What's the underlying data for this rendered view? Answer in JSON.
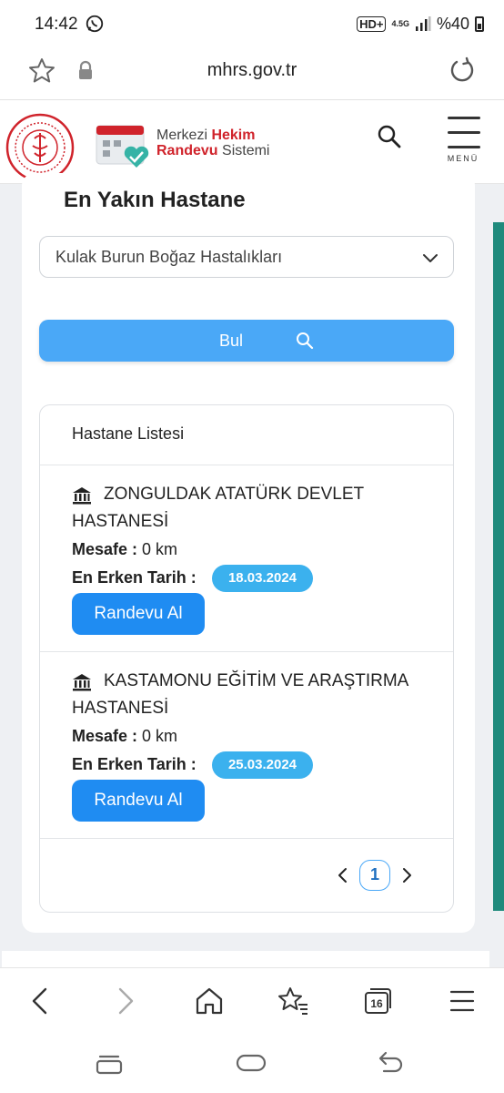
{
  "status_bar": {
    "time": "14:42",
    "network_type": "4.5G",
    "hd_label": "HD+",
    "battery": "%40"
  },
  "browser": {
    "url": "mhrs.gov.tr",
    "tab_count": "16"
  },
  "site_header": {
    "brand_line1_part1": "Merkezi ",
    "brand_line1_part2": "Hekim",
    "brand_line2_part1": "Randevu",
    "brand_line2_part2": " Sistemi",
    "menu_label": "MENÜ"
  },
  "page": {
    "title": "En Yakın Hastane",
    "clinic_select_value": "Kulak Burun Boğaz Hastalıkları",
    "find_button_label": "Bul",
    "list_title": "Hastane Listesi",
    "distance_label": "Mesafe :",
    "earliest_date_label": "En Erken Tarih :",
    "appointment_button_label": "Randevu Al",
    "hospitals": [
      {
        "name": "ZONGULDAK ATATÜRK DEVLET HASTANESİ",
        "distance": "0 km",
        "earliest_date": "18.03.2024"
      },
      {
        "name": "KASTAMONU EĞİTİM VE ARAŞTIRMA HASTANESİ",
        "distance": "0 km",
        "earliest_date": "25.03.2024"
      }
    ],
    "current_page": "1"
  },
  "colors": {
    "primary_button": "#4aa8f7",
    "appointment_button": "#1f8cf2",
    "date_badge": "#3bb1ee",
    "brand_red": "#d0232b",
    "scroll_accent": "#1f8a7c"
  }
}
